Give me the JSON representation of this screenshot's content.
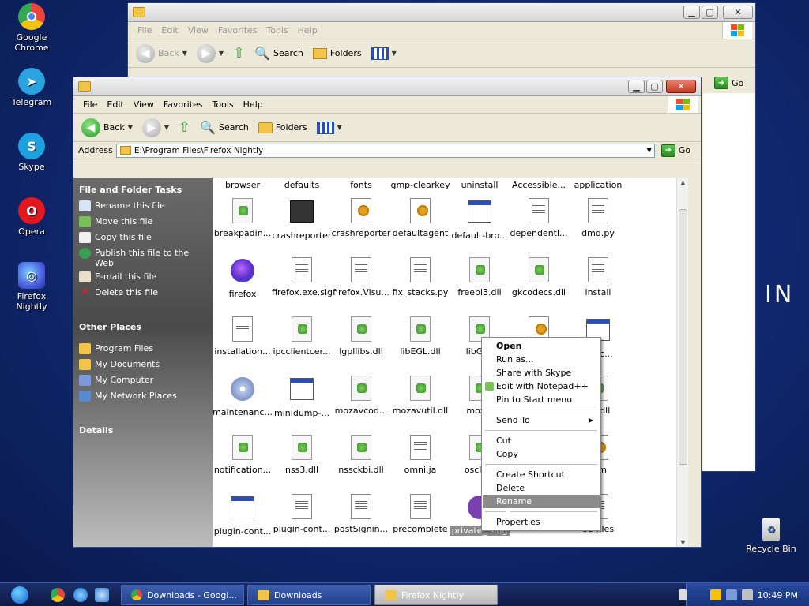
{
  "desktop": {
    "icons": [
      {
        "label": "Google Chrome",
        "color": "#e8453c"
      },
      {
        "label": "Telegram",
        "color": "#2aa3df"
      },
      {
        "label": "Skype",
        "color": "#1fa0e0"
      },
      {
        "label": "Opera",
        "color": "#e2171f"
      },
      {
        "label": "Firefox Nightly",
        "color": "#4b5fe0"
      }
    ],
    "recycle_bin": "Recycle Bin",
    "brand_text": "IN"
  },
  "back_window": {
    "menu": [
      "File",
      "Edit",
      "View",
      "Favorites",
      "Tools",
      "Help"
    ],
    "back_label": "Back",
    "search_label": "Search",
    "folders_label": "Folders",
    "go_label": "Go"
  },
  "window": {
    "menu": [
      "File",
      "Edit",
      "View",
      "Favorites",
      "Tools",
      "Help"
    ],
    "back_label": "Back",
    "search_label": "Search",
    "folders_label": "Folders",
    "address_label": "Address",
    "address_value": "E:\\Program Files\\Firefox Nightly",
    "go_label": "Go",
    "tasks_title": "File and Folder Tasks",
    "tasks": [
      "Rename this file",
      "Move this file",
      "Copy this file",
      "Publish this file to the Web",
      "E-mail this file",
      "Delete this file"
    ],
    "places_title": "Other Places",
    "places": [
      "Program Files",
      "My Documents",
      "My Computer",
      "My Network Places"
    ],
    "details_title": "Details"
  },
  "files": {
    "row0": [
      "browser",
      "defaults",
      "fonts",
      "gmp-clearkey",
      "uninstall",
      "Accessible...",
      "application"
    ],
    "row1": [
      "breakpadin...",
      "crashreporter",
      "crashreporter",
      "defaultagent",
      "default-bro...",
      "dependentl...",
      "dmd.py"
    ],
    "row2": [
      "firefox",
      "firefox.exe.sig",
      "firefox.Visu...",
      "fix_stacks.py",
      "freebl3.dll",
      "gkcodecs.dll",
      "install"
    ],
    "row3": [
      "installation...",
      "ipcclientcer...",
      "lgpllibs.dll",
      "libEGL.dll",
      "libGLE",
      "",
      "nanc..."
    ],
    "row4": [
      "maintenanc...",
      "minidump-...",
      "mozavcod...",
      "mozavutil.dll",
      "mozgl",
      "",
      "40.dll"
    ],
    "row5": [
      "notification...",
      "nss3.dll",
      "nssckbi.dll",
      "omni.ja",
      "osclien",
      "",
      "orm"
    ],
    "row6": [
      "plugin-cont...",
      "plugin-cont...",
      "postSignin...",
      "precomplete",
      "private_ sing",
      "",
      "ed-files"
    ]
  },
  "context_menu": {
    "items": [
      "Open",
      "Run as...",
      "Share with Skype",
      "Edit with Notepad++",
      "Pin to Start menu",
      "Send To",
      "Cut",
      "Copy",
      "Create Shortcut",
      "Delete",
      "Rename",
      "Properties"
    ]
  },
  "taskbar": {
    "tasks": [
      {
        "label": "Downloads - Googl..."
      },
      {
        "label": "Downloads"
      },
      {
        "label": "Firefox Nightly"
      }
    ],
    "clock": "10:49 PM"
  }
}
